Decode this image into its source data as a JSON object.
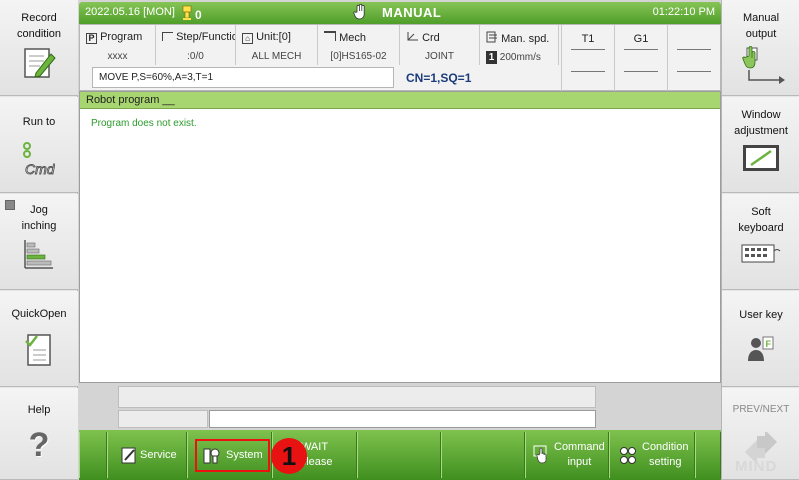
{
  "left_panel": {
    "items": [
      {
        "label": "Record\ncondition",
        "icon": "pencil-notepad-icon"
      },
      {
        "label": "Run to",
        "icon": "cmd-icon"
      },
      {
        "label": "Jog\ninching",
        "icon": "bars-icon"
      },
      {
        "label": "QuickOpen",
        "icon": "checklist-icon"
      },
      {
        "label": "Help",
        "icon": "question-icon"
      }
    ]
  },
  "right_panel": {
    "items": [
      {
        "label": "Manual\noutput",
        "icon": "hand-arrow-icon"
      },
      {
        "label": "Window\nadjustment",
        "icon": "window-adjust-icon"
      },
      {
        "label": "Soft\nkeyboard",
        "icon": "keyboard-icon"
      },
      {
        "label": "User key",
        "icon": "user-key-icon"
      },
      {
        "label": "PREV/NEXT",
        "icon": "prev-next-icon"
      }
    ]
  },
  "header": {
    "date": "2022.05.16 [MON]",
    "counter": "0",
    "mode": "MANUAL",
    "time": "01:22:10 PM"
  },
  "info": {
    "program": {
      "title": "Program",
      "value": "xxxx"
    },
    "step": {
      "title": "Step/Functio",
      "value": ":0/0"
    },
    "unit": {
      "title": "Unit:[0]",
      "value": "ALL MECH"
    },
    "mech": {
      "title": "Mech",
      "value": "[0]HS165-02"
    },
    "crd": {
      "title": "Crd",
      "value": "JOINT"
    },
    "speed": {
      "title": "Man. spd.",
      "value": "200mm/s",
      "level": "1"
    },
    "command": "MOVE P,S=60%,A=3,T=1",
    "cn_sq": "CN=1,SQ=1",
    "tool_slots": [
      "T1",
      "G1",
      ""
    ]
  },
  "program_panel": {
    "title": "Robot program __",
    "message": "Program does not exist."
  },
  "toolbar": {
    "service": "Service",
    "system": "System",
    "wait_release": "WAIT\nrelease",
    "command_input": "Command\ninput",
    "condition_setting": "Condition\nsetting"
  },
  "annotation": {
    "number": "1"
  },
  "brand": "MIND",
  "colors": {
    "accent": "#4f9e2a",
    "highlight": "#e11111"
  }
}
